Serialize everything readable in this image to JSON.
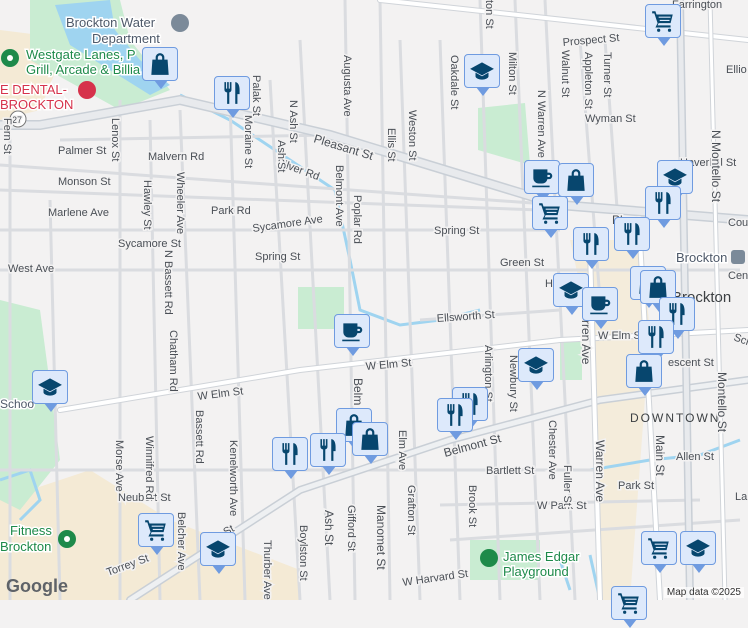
{
  "pois": {
    "water_dept_1": "Brockton Water",
    "water_dept_2": "Department",
    "westgate_1": "Westgate Lanes, P",
    "westgate_2": "Grill, Arcade & Billia",
    "dental_1": "E DENTAL-",
    "dental_2": "BROCKTON",
    "fitness_1": "Fitness",
    "fitness_2": "Brockton",
    "school_left": "Schoo",
    "playground_1": "James Edgar",
    "playground_2": "Playground",
    "brockton_station": "Brockton",
    "city": "Brockton",
    "downtown": "DOWNTOWN",
    "route": "27"
  },
  "streets": {
    "prospect": "Prospect St",
    "farrington": "Farrington",
    "elliot": "Ellio",
    "pleasant": "Pleasant St",
    "pleasant2": "Pleas",
    "palmer": "Palmer St",
    "malvern": "Malvern Rd",
    "monson": "Monson St",
    "marlene": "Marlene Ave",
    "park_rd": "Park Rd",
    "sycamore_ave": "Sycamore Ave",
    "sycamore_st": "Sycamore St",
    "west_ave": "West Ave",
    "spring1": "Spring St",
    "spring2": "Spring St",
    "green": "Green St",
    "highland": "Highlan",
    "ellsworth": "Ellsworth St",
    "welm1": "W Elm St",
    "welm2": "W Elm St",
    "welm3": "W Elm S",
    "belmont": "Belmont St",
    "bartlett": "Bartlett St",
    "allen": "Allen St",
    "park_st": "Park St",
    "wpark": "W Park St",
    "neubert": "Neubert St",
    "torrey": "Torrey St",
    "wharvard": "W Harvard St",
    "haverhill": "Haverhill St",
    "wyman": "Wyman St",
    "court": "Cou",
    "crescent": "escent St",
    "lenox": "Lenox St",
    "fern": "Fern St",
    "hawley": "Hawley St",
    "wheeler": "Wheeler Ave",
    "nbassett": "N Bassett Rd",
    "chatham": "Chatham Rd",
    "bassett": "Bassett Rd",
    "winnifred": "Winnifred Rd",
    "morse": "Morse Ave",
    "belcher": "Belcher Ave",
    "kenelworth": "Kenelworth Ave",
    "thurber": "Thurber Ave",
    "boylston": "Boylston St",
    "ash_s": "Ash St",
    "gifford": "Gifford St",
    "manomet": "Manomet St",
    "elm_ave": "Elm Ave",
    "grafton": "Grafton St",
    "brook": "Brook St",
    "arlington": "Arlington St",
    "newbury": "Newbury St",
    "chester": "Chester Ave",
    "fuller": "Fuller St",
    "warren": "Warren Ave",
    "warren2": "rren Ave",
    "main": "Main St",
    "nmontello": "N Montello St",
    "montello": "Montello St",
    "moraine": "Moraine St",
    "ash_n": "Ash St",
    "nash": "N Ash St",
    "augusta": "Augusta Ave",
    "belmont_ave": "Belmont Ave",
    "poplar": "Poplar Rd",
    "ellis": "Ellis St",
    "weston": "Weston St",
    "oakdale": "Oakdale St",
    "milton": "Milton St",
    "nwarren": "N Warren Ave",
    "walnut": "Walnut St",
    "appleton": "Appleton St",
    "turner": "Turner St",
    "silver": "Silver Rd",
    "palak": "Palak St",
    "belm": "Belm",
    "ton": "ton St",
    "lal": "La",
    "sch": "Sch",
    "cen": "Cen"
  },
  "footer": {
    "logo": "Google",
    "attribution": "Map data ©2025"
  }
}
